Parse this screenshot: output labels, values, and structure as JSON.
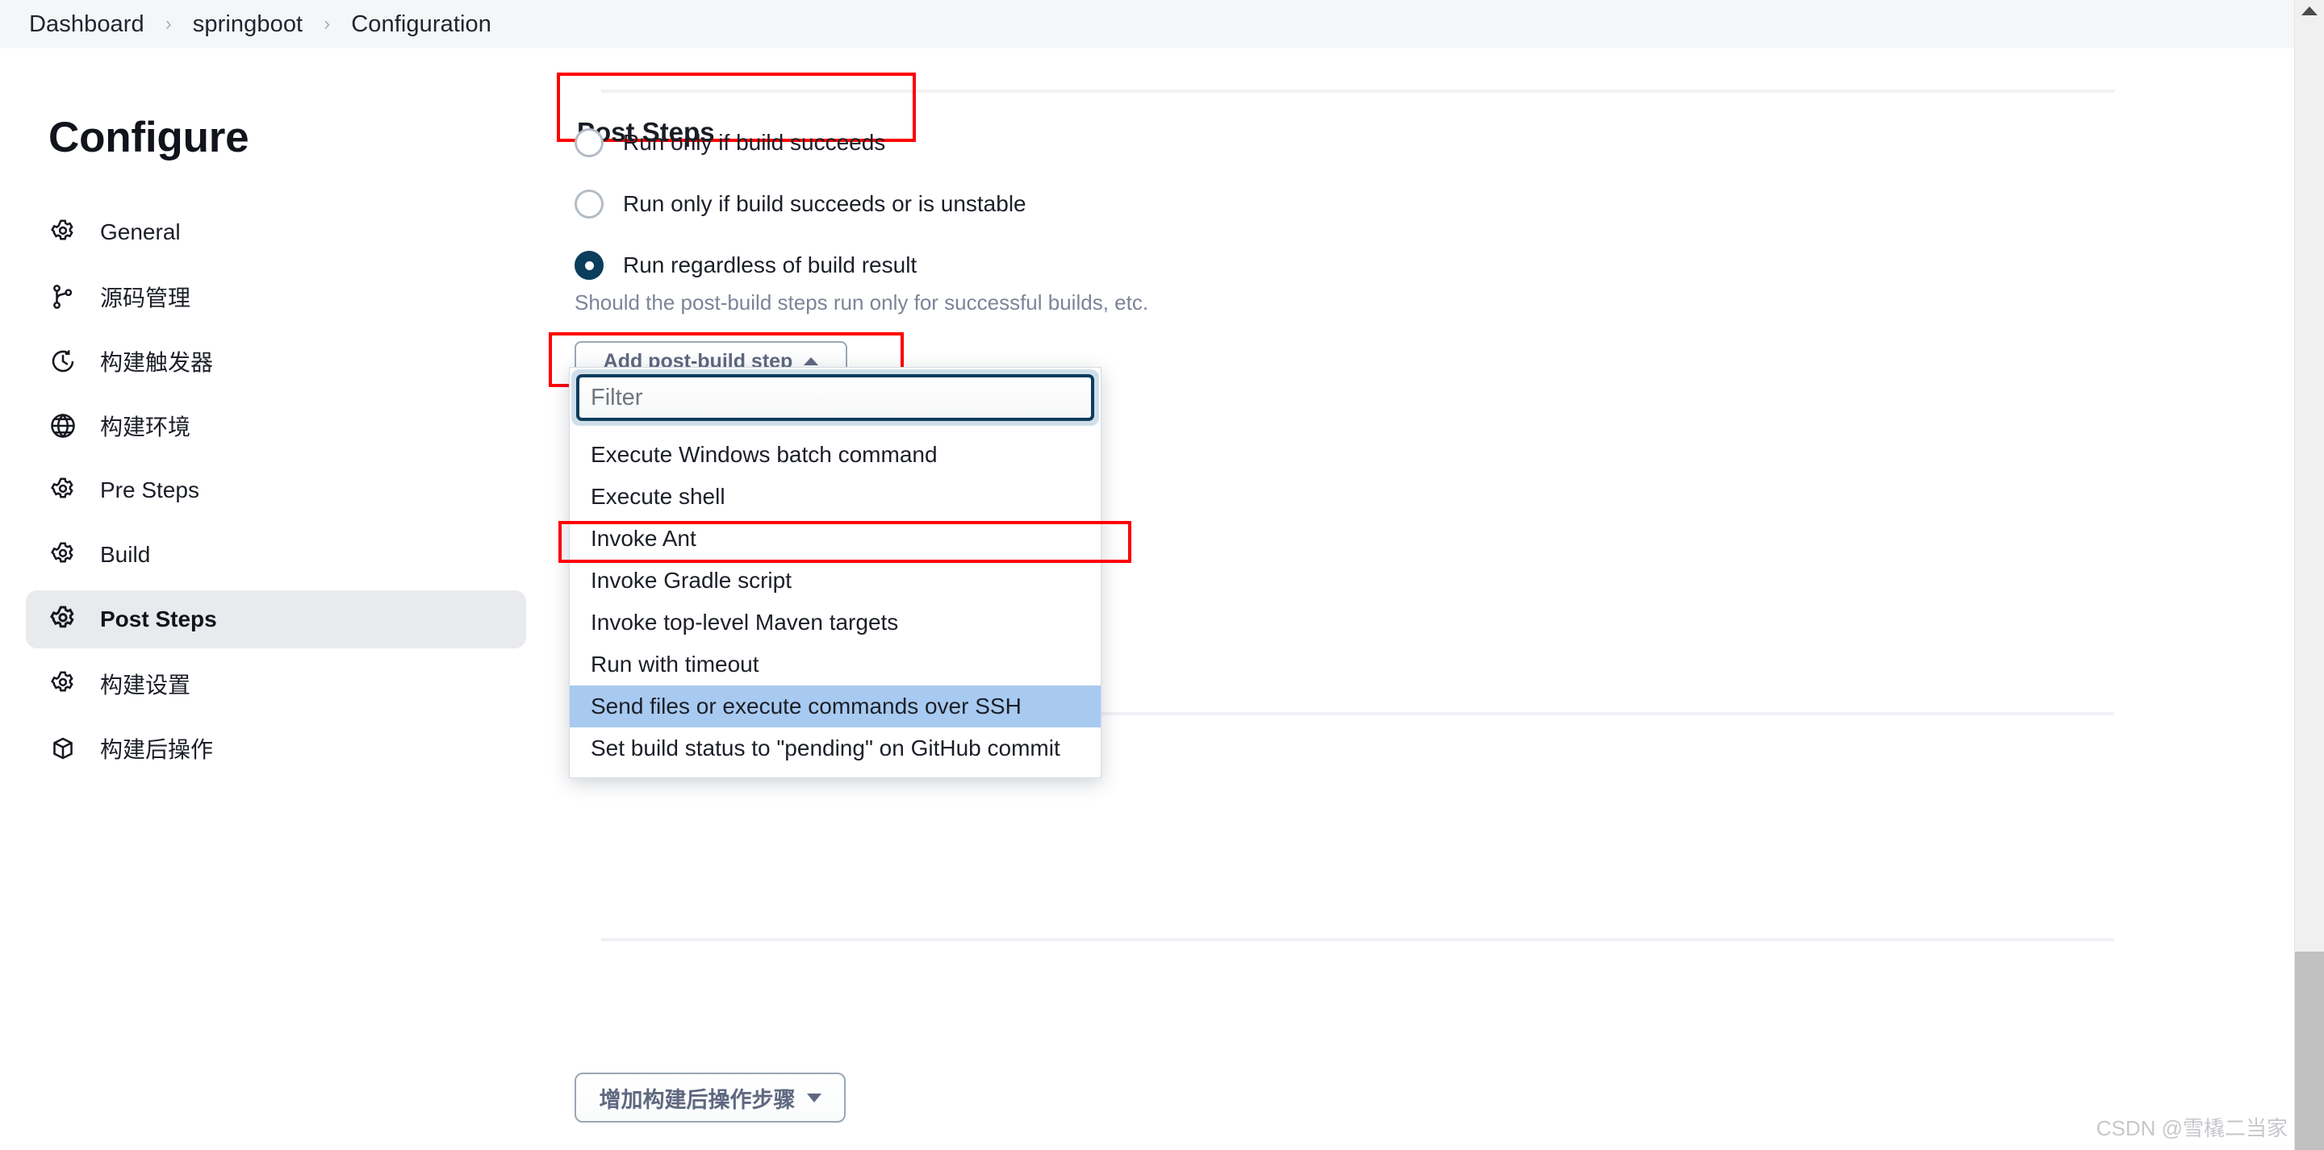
{
  "breadcrumb": {
    "items": [
      "Dashboard",
      "springboot",
      "Configuration"
    ],
    "separator": "›"
  },
  "sidebar": {
    "title": "Configure",
    "items": [
      {
        "label": "General",
        "icon": "gear-icon",
        "selected": false
      },
      {
        "label": "源码管理",
        "icon": "git-branch-icon",
        "selected": false
      },
      {
        "label": "构建触发器",
        "icon": "clock-icon",
        "selected": false
      },
      {
        "label": "构建环境",
        "icon": "globe-icon",
        "selected": false
      },
      {
        "label": "Pre Steps",
        "icon": "gear-icon",
        "selected": false
      },
      {
        "label": "Build",
        "icon": "gear-icon",
        "selected": false
      },
      {
        "label": "Post Steps",
        "icon": "gear-icon",
        "selected": true
      },
      {
        "label": "构建设置",
        "icon": "gear-icon",
        "selected": false
      },
      {
        "label": "构建后操作",
        "icon": "package-icon",
        "selected": false
      }
    ]
  },
  "main": {
    "section_title": "Post Steps",
    "radios": [
      {
        "label": "Run only if build succeeds",
        "checked": false
      },
      {
        "label": "Run only if build succeeds or is unstable",
        "checked": false
      },
      {
        "label": "Run regardless of build result",
        "checked": true
      }
    ],
    "help_text": "Should the post-build steps run only for successful builds, etc.",
    "add_button": {
      "label": "Add post-build step",
      "caret": "caret-up-icon"
    },
    "dropdown": {
      "filter_value": "",
      "filter_placeholder": "Filter",
      "items": [
        {
          "label": "Execute Windows batch command",
          "highlighted": false
        },
        {
          "label": "Execute shell",
          "highlighted": false
        },
        {
          "label": "Invoke Ant",
          "highlighted": false
        },
        {
          "label": "Invoke Gradle script",
          "highlighted": false
        },
        {
          "label": "Invoke top-level Maven targets",
          "highlighted": false
        },
        {
          "label": "Run with timeout",
          "highlighted": false
        },
        {
          "label": "Send files or execute commands over SSH",
          "highlighted": true
        },
        {
          "label": "Set build status to \"pending\" on GitHub commit",
          "highlighted": false
        }
      ]
    },
    "bottom_button": {
      "label": "增加构建后操作步骤",
      "caret": "caret-down-icon"
    }
  },
  "annotations": {
    "highlight_color": "#ff0000",
    "selected_row_color": "#a8caf0",
    "accent_color": "#0b3d5c"
  },
  "watermark": "CSDN @雪橇二当家"
}
